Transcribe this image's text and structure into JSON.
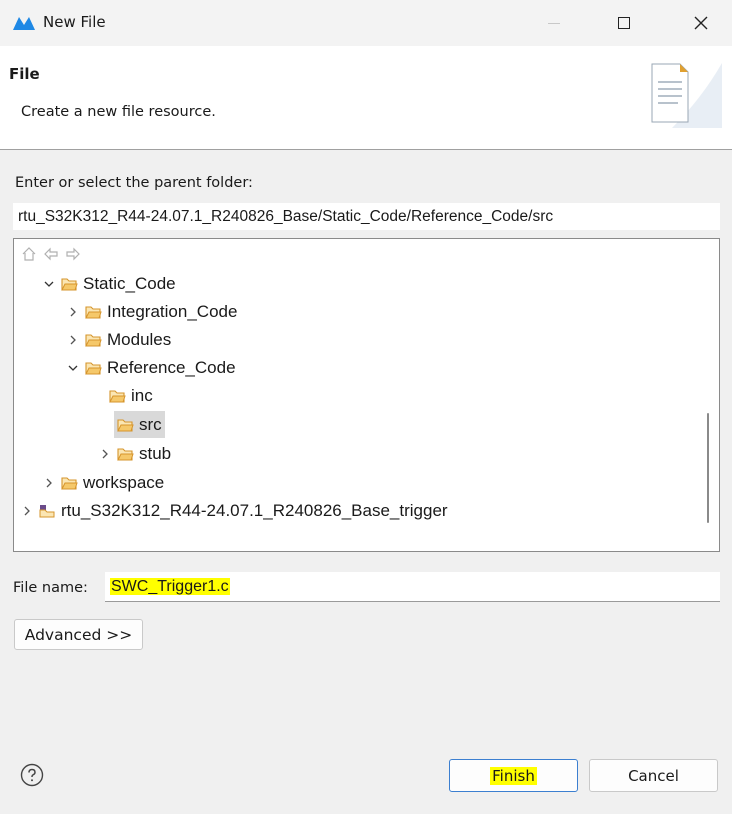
{
  "window": {
    "title": "New File"
  },
  "banner": {
    "title": "File",
    "description": "Create a new file resource."
  },
  "parent_folder": {
    "label": "Enter or select the parent folder:",
    "path": "rtu_S32K312_R44-24.07.1_R240826_Base/Static_Code/Reference_Code/src"
  },
  "tree": {
    "items": [
      {
        "label": "Static_Code",
        "expanded": true
      },
      {
        "label": "Integration_Code",
        "expanded": false
      },
      {
        "label": "Modules",
        "expanded": false
      },
      {
        "label": "Reference_Code",
        "expanded": true
      },
      {
        "label": "inc"
      },
      {
        "label": "src",
        "selected": true
      },
      {
        "label": "stub",
        "expanded": false
      },
      {
        "label": "workspace",
        "expanded": false
      },
      {
        "label": "rtu_S32K312_R44-24.07.1_R240826_Base_trigger",
        "expanded": false
      }
    ]
  },
  "file_name": {
    "label": "File name:",
    "value": "SWC_Trigger1.c"
  },
  "buttons": {
    "advanced": "Advanced >>",
    "finish": "Finish",
    "cancel": "Cancel"
  },
  "colors": {
    "highlight": "#ffff00",
    "folder": "#e6a635",
    "accent": "#3c7fd0"
  },
  "icons": [
    "app-logo-icon",
    "minimize-icon",
    "maximize-icon",
    "close-icon",
    "new-file-wizard-icon",
    "home-icon",
    "back-arrow-icon",
    "forward-arrow-icon",
    "folder-icon",
    "project-icon",
    "help-icon"
  ]
}
